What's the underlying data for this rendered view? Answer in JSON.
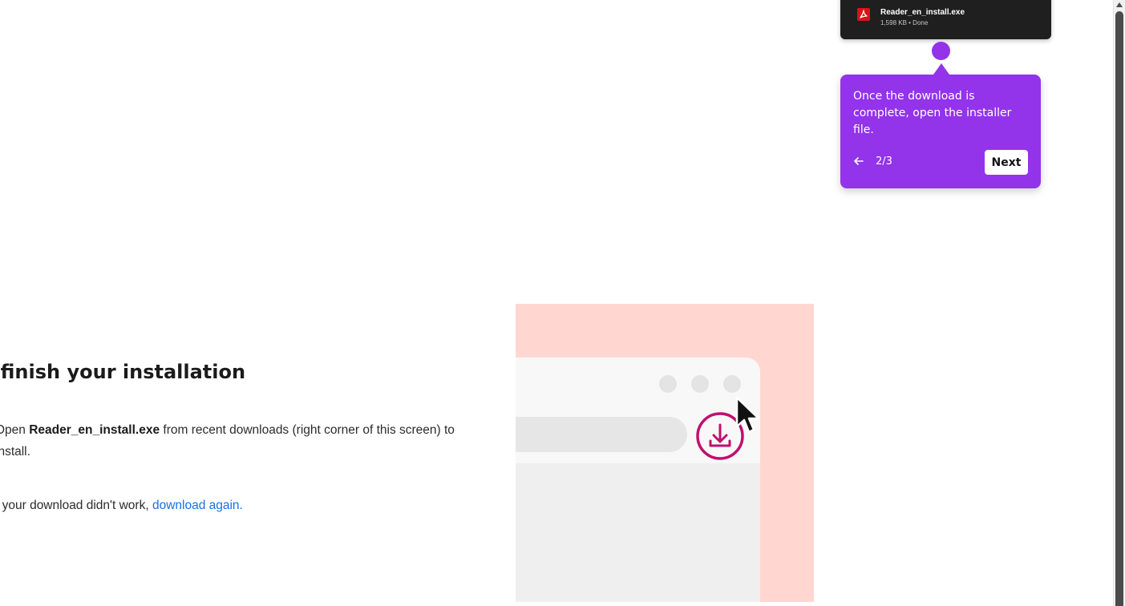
{
  "download": {
    "filename": "Reader_en_install.exe",
    "meta": "1,598 KB • Done",
    "icon": "pdf-icon"
  },
  "tooltip": {
    "message": "Once the download is complete, open the installer file.",
    "step": "2/3",
    "next_label": "Next",
    "back_icon": "arrow-left-icon",
    "color": "#9333ea"
  },
  "main": {
    "heading": "s finish your installation",
    "instruction_prefix": "Open ",
    "instruction_file": "Reader_en_install.exe",
    "instruction_suffix": " from recent downloads (right corner of this screen) to install.",
    "retry_prefix": "f your download didn't work, ",
    "retry_link": "download again."
  },
  "illustration": {
    "background": "#ffd7d0",
    "icons": [
      "download-circle-icon",
      "mouse-cursor-icon"
    ]
  },
  "colors": {
    "accent": "#9333ea",
    "link": "#1473e6",
    "download_icon": "#c0106f",
    "popup_bg": "#1f1f1f"
  }
}
